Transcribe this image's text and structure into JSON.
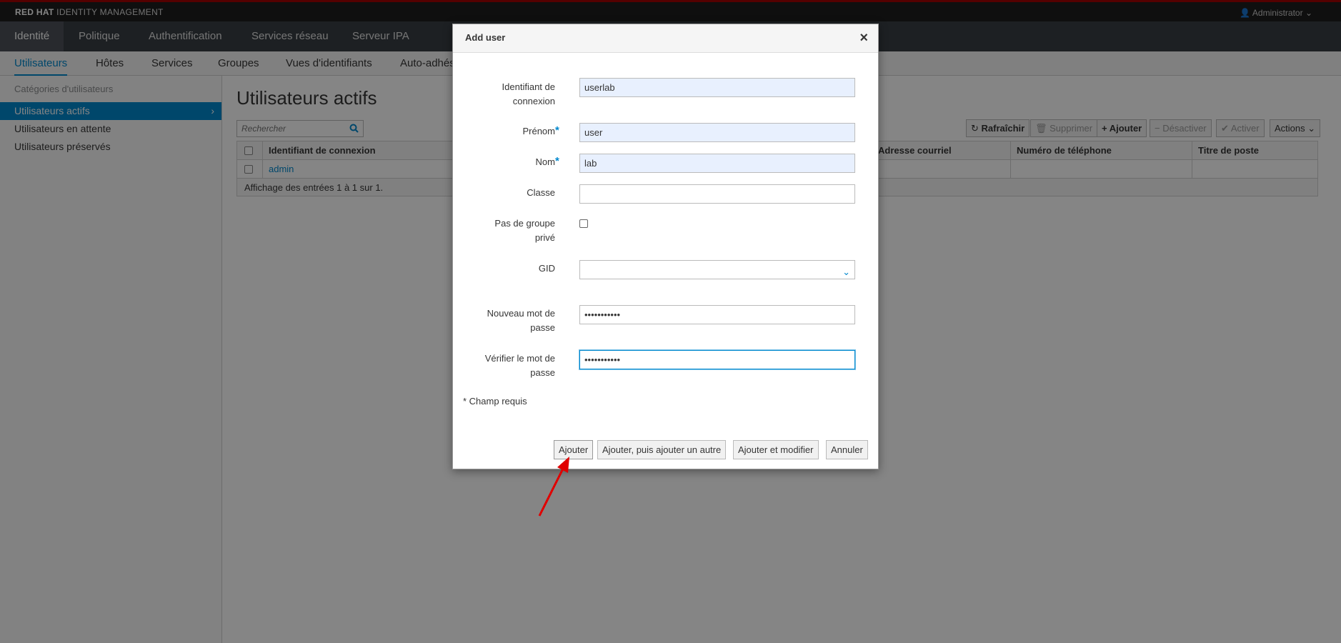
{
  "brand": {
    "bold": "RED HAT",
    "rest": " IDENTITY MANAGEMENT"
  },
  "user_menu": {
    "label": "Administrator",
    "icon": "user-icon",
    "caret": "chevron-down-icon"
  },
  "primary_nav": [
    "Identité",
    "Politique",
    "Authentification",
    "Services réseau",
    "Serveur IPA"
  ],
  "secondary_nav": [
    "Utilisateurs",
    "Hôtes",
    "Services",
    "Groupes",
    "Vues d'identifiants",
    "Auto-adhésion"
  ],
  "sidebar": {
    "title": "Catégories d'utilisateurs",
    "items": [
      "Utilisateurs actifs",
      "Utilisateurs en attente",
      "Utilisateurs préservés"
    ]
  },
  "main": {
    "title": "Utilisateurs actifs",
    "search_placeholder": "Rechercher",
    "toolbar": {
      "refresh": "Rafraîchir",
      "delete": "Supprimer",
      "add": "Ajouter",
      "disable": "Désactiver",
      "enable": "Activer",
      "actions": "Actions"
    },
    "table": {
      "columns": [
        "Identifiant de connexion",
        "Adresse courriel",
        "Numéro de téléphone",
        "Titre de poste"
      ],
      "rows": [
        {
          "login": "admin"
        }
      ],
      "footer": "Affichage des entrées 1 à 1 sur 1."
    }
  },
  "dialog": {
    "title": "Add user",
    "fields": {
      "login_label_1": "Identifiant de",
      "login_label_2": "connexion",
      "login_value": "userlab",
      "first_name_label": "Prénom",
      "first_name_value": "user",
      "last_name_label": "Nom",
      "last_name_value": "lab",
      "class_label": "Classe",
      "class_value": "",
      "noprivate_label_1": "Pas de groupe",
      "noprivate_label_2": "privé",
      "gid_label": "GID",
      "gid_value": "",
      "password_label_1": "Nouveau mot de",
      "password_label_2": "passe",
      "password_value": "•••••••••••",
      "verify_label_1": "Vérifier le mot de",
      "verify_label_2": "passe",
      "verify_value": "•••••••••••"
    },
    "required_star": "*",
    "required_note": "* Champ requis",
    "buttons": {
      "add": "Ajouter",
      "add_another": "Ajouter, puis ajouter un autre",
      "add_edit": "Ajouter et modifier",
      "cancel": "Annuler"
    }
  },
  "colors": {
    "accent": "#0088ce",
    "annotation_arrow": "#e00000",
    "brand_stripe": "#a30000"
  }
}
